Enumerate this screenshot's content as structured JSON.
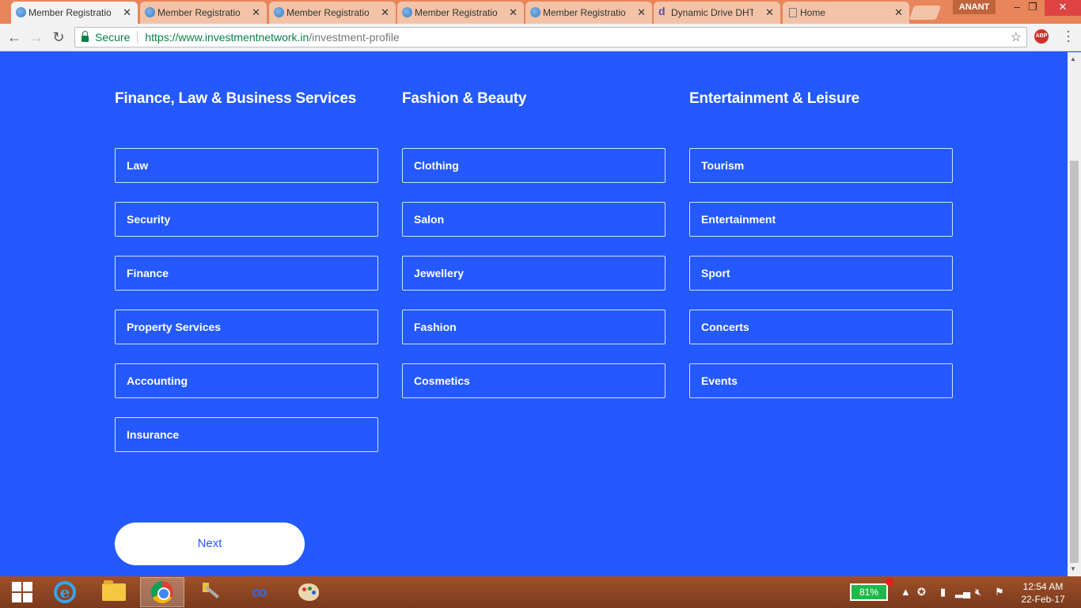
{
  "browser": {
    "tabs": [
      {
        "label": "Member Registratio",
        "favicon": "globe-icon",
        "active": true
      },
      {
        "label": "Member Registratio",
        "favicon": "globe-icon",
        "active": false
      },
      {
        "label": "Member Registratio",
        "favicon": "globe-icon",
        "active": false
      },
      {
        "label": "Member Registratio",
        "favicon": "globe-icon",
        "active": false
      },
      {
        "label": "Member Registratio",
        "favicon": "globe-icon",
        "active": false
      },
      {
        "label": "Dynamic Drive DHT",
        "favicon": "dynamic-drive-icon",
        "active": false
      },
      {
        "label": "Home",
        "favicon": "page-icon",
        "active": false
      }
    ],
    "close_glyph": "✕",
    "user_name": "ANANT",
    "secure_label": "Secure",
    "url_host": "https://www.investmentnetwork.in",
    "url_path": "/investment-profile",
    "abp_label": "ABP"
  },
  "page": {
    "columns": [
      {
        "title": "Finance, Law & Business Services",
        "options": [
          "Law",
          "Security",
          "Finance",
          "Property Services",
          "Accounting",
          "Insurance"
        ]
      },
      {
        "title": "Fashion & Beauty",
        "options": [
          "Clothing",
          "Salon",
          "Jewellery",
          "Fashion",
          "Cosmetics"
        ]
      },
      {
        "title": "Entertainment & Leisure",
        "options": [
          "Tourism",
          "Entertainment",
          "Sport",
          "Concerts",
          "Events"
        ]
      }
    ],
    "next_label": "Next",
    "colors": {
      "background": "#2359fe",
      "text": "#ffffff",
      "button_text": "#2359fe"
    }
  },
  "taskbar": {
    "battery_percent": "81%",
    "time": "12:54 AM",
    "date": "22-Feb-17"
  }
}
